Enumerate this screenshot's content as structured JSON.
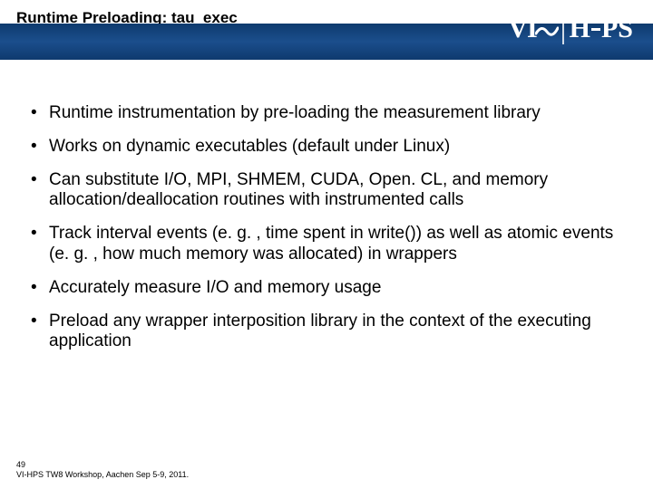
{
  "header": {
    "title": "Runtime Preloading: tau_exec",
    "logo": {
      "vi": "VI",
      "hps": "HPS"
    }
  },
  "bullets": [
    "Runtime instrumentation by pre-loading the measurement library",
    "Works on dynamic executables (default under Linux)",
    "Can substitute I/O, MPI, SHMEM, CUDA, Open. CL, and memory allocation/deallocation routines with instrumented calls",
    "Track interval events (e. g. , time spent in write()) as well as atomic events (e. g. , how much memory was allocated) in wrappers",
    "Accurately measure I/O and memory usage",
    "Preload any wrapper interposition library in the context of the executing application"
  ],
  "footer": {
    "page": "49",
    "line": "VI-HPS TW8 Workshop, Aachen Sep 5-9, 2011."
  }
}
